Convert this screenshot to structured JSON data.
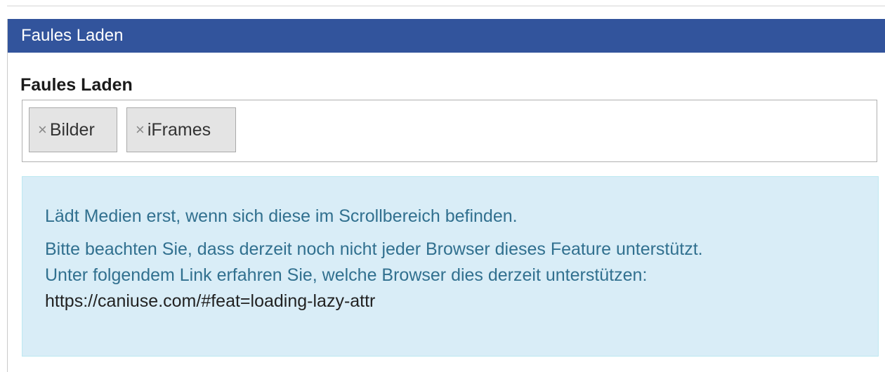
{
  "panel": {
    "title": "Faules Laden"
  },
  "field": {
    "label": "Faules Laden",
    "tags": [
      {
        "remove_symbol": "×",
        "label": "Bilder"
      },
      {
        "remove_symbol": "×",
        "label": "iFrames"
      }
    ]
  },
  "info": {
    "line1": "Lädt Medien erst, wenn sich diese im Scrollbereich befinden.",
    "line2": "Bitte beachten Sie, dass derzeit noch nicht jeder Browser dieses Feature unterstützt.",
    "line3": "Unter folgendem Link erfahren Sie, welche Browser dies derzeit unterstützen:",
    "link": "https://caniuse.com/#feat=loading-lazy-attr"
  },
  "colors": {
    "header_bg": "#32549c",
    "info_bg": "#d9edf7",
    "info_text": "#31708f"
  }
}
